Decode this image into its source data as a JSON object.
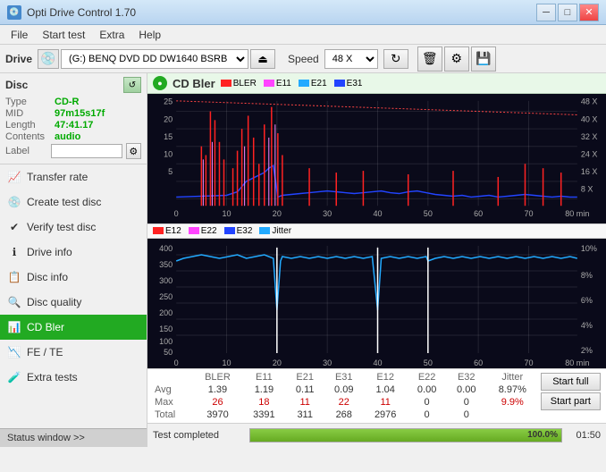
{
  "titleBar": {
    "icon": "💿",
    "title": "Opti Drive Control 1.70"
  },
  "menuBar": {
    "items": [
      "File",
      "Start test",
      "Extra",
      "Help"
    ]
  },
  "driveBar": {
    "driveLabel": "Drive",
    "driveValue": "(G:)  BENQ DVD DD DW1640 BSRB",
    "speedLabel": "Speed",
    "speedValue": "48 X"
  },
  "disc": {
    "title": "Disc",
    "type": {
      "label": "Type",
      "value": "CD-R"
    },
    "mid": {
      "label": "MID",
      "value": "97m15s17f"
    },
    "length": {
      "label": "Length",
      "value": "47:41.17"
    },
    "contents": {
      "label": "Contents",
      "value": "audio"
    },
    "label": {
      "label": "Label",
      "value": ""
    }
  },
  "navItems": [
    {
      "id": "transfer-rate",
      "label": "Transfer rate",
      "icon": "📈"
    },
    {
      "id": "create-test-disc",
      "label": "Create test disc",
      "icon": "💿"
    },
    {
      "id": "verify-test-disc",
      "label": "Verify test disc",
      "icon": "✔"
    },
    {
      "id": "drive-info",
      "label": "Drive info",
      "icon": "ℹ"
    },
    {
      "id": "disc-info",
      "label": "Disc info",
      "icon": "📋"
    },
    {
      "id": "disc-quality",
      "label": "Disc quality",
      "icon": "🔍"
    },
    {
      "id": "cd-bler",
      "label": "CD Bler",
      "icon": "📊",
      "active": true
    },
    {
      "id": "fe-te",
      "label": "FE / TE",
      "icon": "📉"
    },
    {
      "id": "extra-tests",
      "label": "Extra tests",
      "icon": "🧪"
    }
  ],
  "statusWindow": "Status window >>",
  "chart1": {
    "title": "CD Bler",
    "legendItems": [
      {
        "label": "BLER",
        "color": "#ff2222"
      },
      {
        "label": "E11",
        "color": "#ff44ff"
      },
      {
        "label": "E21",
        "color": "#22aaff"
      },
      {
        "label": "E31",
        "color": "#2244ff"
      }
    ],
    "yLabels": [
      "25",
      "20",
      "15",
      "10",
      "5"
    ],
    "yLabelsRight": [
      "48 X",
      "40 X",
      "32 X",
      "24 X",
      "16 X",
      "8 X"
    ],
    "xLabels": [
      "0",
      "10",
      "20",
      "30",
      "40",
      "50",
      "60",
      "70",
      "80 min"
    ]
  },
  "chart2": {
    "legendItems": [
      {
        "label": "E12",
        "color": "#ff2222"
      },
      {
        "label": "E22",
        "color": "#ff44ff"
      },
      {
        "label": "E32",
        "color": "#2244ff"
      },
      {
        "label": "Jitter",
        "color": "#22aaff"
      }
    ],
    "yLabels": [
      "400",
      "350",
      "300",
      "250",
      "200",
      "150",
      "100",
      "50"
    ],
    "yLabelsRight": [
      "10%",
      "8%",
      "6%",
      "4%",
      "2%"
    ],
    "xLabels": [
      "0",
      "10",
      "20",
      "30",
      "40",
      "50",
      "60",
      "70",
      "80 min"
    ]
  },
  "dataTable": {
    "headers": [
      "",
      "BLER",
      "E11",
      "E21",
      "E31",
      "E12",
      "E22",
      "E32",
      "Jitter",
      ""
    ],
    "rows": [
      {
        "label": "Avg",
        "values": [
          "1.39",
          "1.19",
          "0.11",
          "0.09",
          "1.04",
          "0.00",
          "0.00",
          "8.97%"
        ]
      },
      {
        "label": "Max",
        "values": [
          "26",
          "18",
          "11",
          "22",
          "11",
          "0",
          "0",
          "9.9%"
        ]
      },
      {
        "label": "Total",
        "values": [
          "3970",
          "3391",
          "311",
          "268",
          "2976",
          "0",
          "0",
          ""
        ]
      }
    ]
  },
  "buttons": {
    "startFull": "Start full",
    "startPart": "Start part"
  },
  "progress": {
    "statusText": "Test completed",
    "percentage": "100.0%",
    "fillPercent": 100,
    "time": "01:50"
  }
}
